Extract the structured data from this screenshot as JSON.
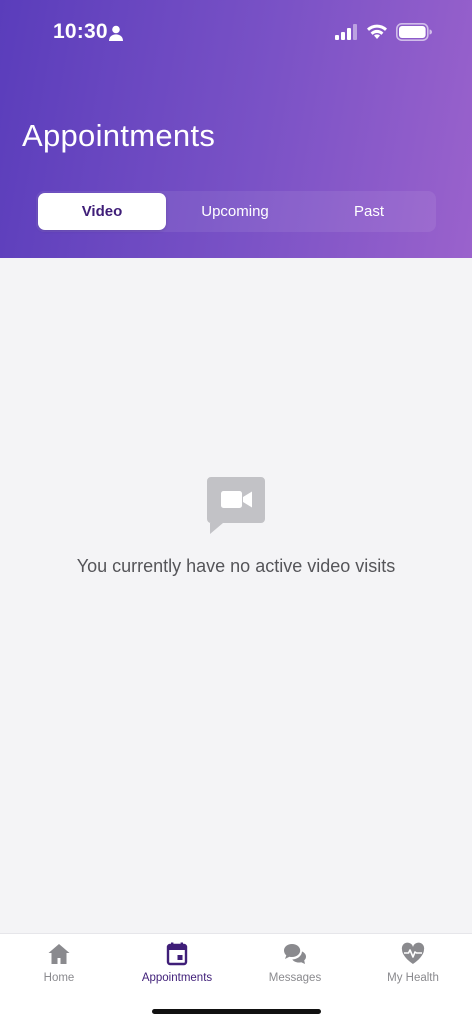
{
  "status_bar": {
    "time": "10:30"
  },
  "header": {
    "title": "Appointments",
    "tabs": [
      {
        "label": "Video",
        "active": true
      },
      {
        "label": "Upcoming",
        "active": false
      },
      {
        "label": "Past",
        "active": false
      }
    ]
  },
  "empty_state": {
    "icon": "video-chat-icon",
    "message": "You currently have no active video visits"
  },
  "tab_bar": {
    "items": [
      {
        "label": "Home",
        "icon": "home-icon",
        "active": false
      },
      {
        "label": "Appointments",
        "icon": "calendar-icon",
        "active": true
      },
      {
        "label": "Messages",
        "icon": "chat-bubbles-icon",
        "active": false
      },
      {
        "label": "My Health",
        "icon": "heart-pulse-icon",
        "active": false
      }
    ]
  },
  "colors": {
    "header_gradient_start": "#5a3dbb",
    "header_gradient_end": "#9a62cc",
    "accent": "#3f1e78",
    "inactive": "#8a8a8e"
  }
}
